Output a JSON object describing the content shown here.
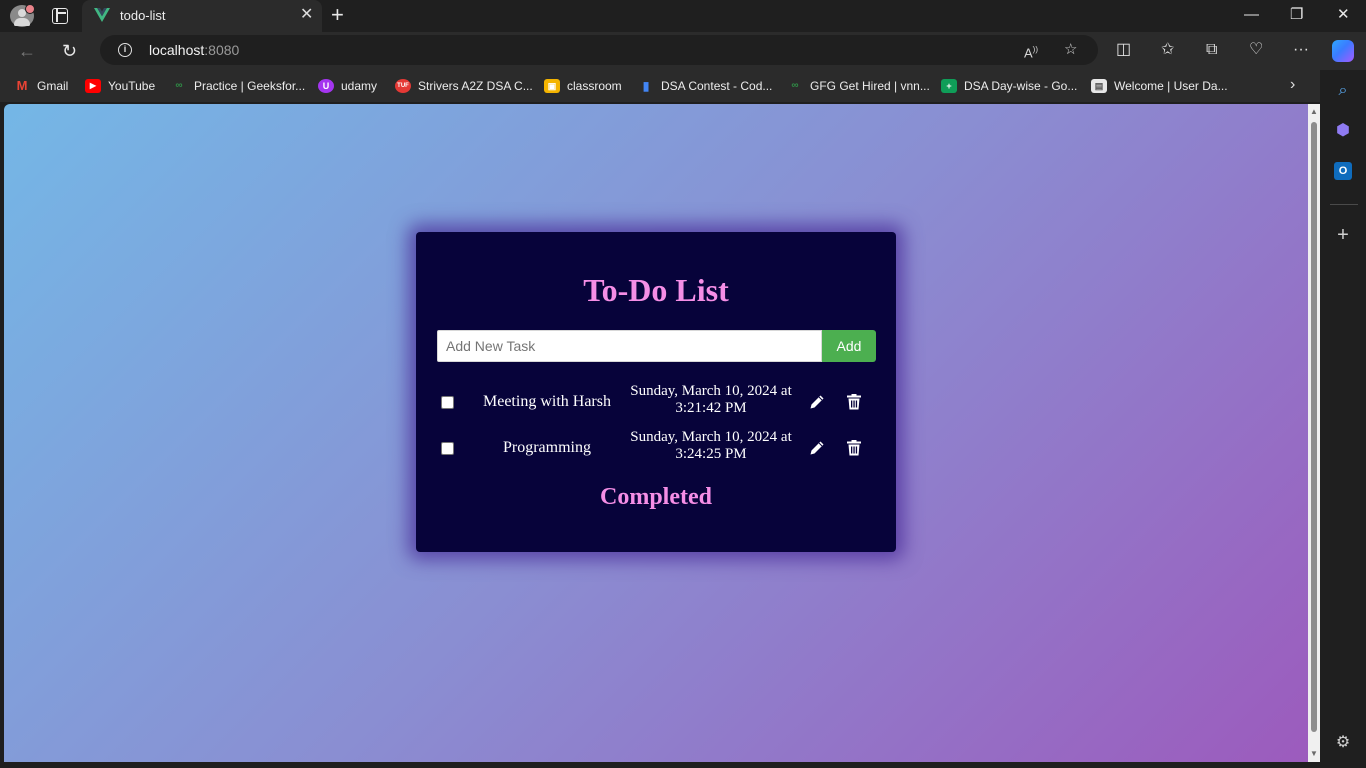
{
  "browser": {
    "tab": {
      "title": "todo-list",
      "favicon": "vue-icon",
      "close_glyph": "✕"
    },
    "new_tab_glyph": "+",
    "window_controls": {
      "minimize": "—",
      "restore": "❐",
      "close": "✕"
    },
    "address": {
      "host": "localhost",
      "port": ":8080"
    },
    "bookmarks": [
      {
        "label": "Gmail",
        "icon": "gmail-icon",
        "color": "#ea4335"
      },
      {
        "label": "YouTube",
        "icon": "youtube-icon",
        "color": "#ff0000"
      },
      {
        "label": "Practice | Geeksfor...",
        "icon": "geeksforgeeks-icon",
        "color": "#2f8d46"
      },
      {
        "label": "udamy",
        "icon": "udemy-icon",
        "color": "#a435f0"
      },
      {
        "label": "Strivers A2Z DSA C...",
        "icon": "takeuforward-icon",
        "color": "#e53935"
      },
      {
        "label": "classroom",
        "icon": "classroom-icon",
        "color": "#f4b400"
      },
      {
        "label": "DSA Contest - Cod...",
        "icon": "codechef-bars-icon",
        "color": "#4285f4"
      },
      {
        "label": "GFG Get Hired | vnn...",
        "icon": "geeksforgeeks-icon",
        "color": "#2f8d46"
      },
      {
        "label": "DSA Day-wise - Go...",
        "icon": "google-sheets-icon",
        "color": "#0f9d58"
      },
      {
        "label": "Welcome | User Da...",
        "icon": "page-icon",
        "color": "#e8e8e8"
      }
    ],
    "bookmarks_more_glyph": "›"
  },
  "app": {
    "title": "To-Do List",
    "input": {
      "placeholder": "Add New Task",
      "value": ""
    },
    "add_label": "Add",
    "tasks": [
      {
        "name": "Meeting with Harsh",
        "date_line1": "Sunday, March 10, 2024 at",
        "date_line2": "3:21:42 PM",
        "checked": false
      },
      {
        "name": "Programming",
        "date_line1": "Sunday, March 10, 2024 at",
        "date_line2": "3:24:25 PM",
        "checked": false
      }
    ],
    "completed_title": "Completed",
    "colors": {
      "card_bg": "#07033a",
      "title": "#f58ee6",
      "add_button": "#4caf50"
    }
  }
}
